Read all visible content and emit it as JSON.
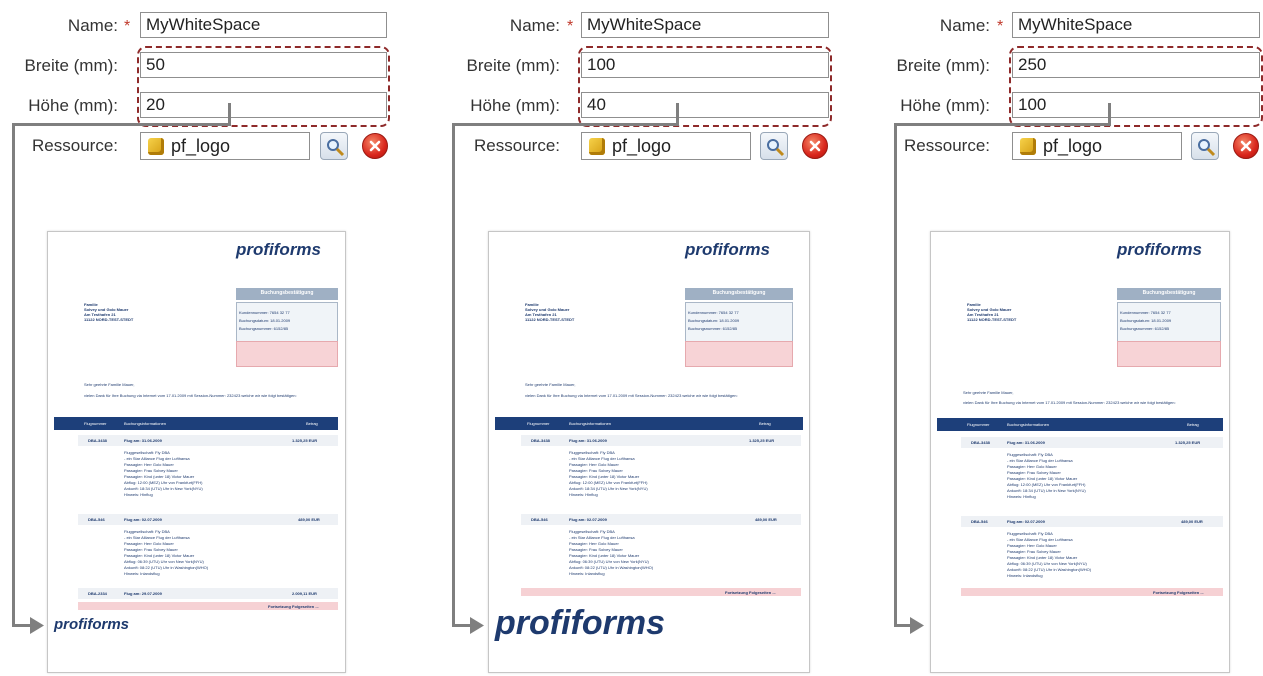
{
  "labels": {
    "name": "Name:",
    "required": "*",
    "breite": "Breite (mm):",
    "hoehe": "Höhe (mm):",
    "ressource": "Ressource:"
  },
  "panels": [
    {
      "name": "MyWhiteSpace",
      "breite": "50",
      "hoehe": "20",
      "resource": "pf_logo"
    },
    {
      "name": "MyWhiteSpace",
      "breite": "100",
      "hoehe": "40",
      "resource": "pf_logo"
    },
    {
      "name": "MyWhiteSpace",
      "breite": "250",
      "hoehe": "100",
      "resource": "pf_logo"
    }
  ],
  "icons": {
    "resource": "cube-icon",
    "search": "magnifier-icon",
    "delete": "delete-x-icon"
  },
  "colors": {
    "highlight": "#8e2a2a",
    "brand": "#1e3a6e",
    "required": "#c0392b"
  },
  "document": {
    "logo": "profiforms",
    "address": [
      "Familie",
      "Solvey und Golo Mauer",
      "Am Testhafen 21",
      "11122 NORD-TEST-STEDT"
    ],
    "booking_title": "Buchungsbestätigung",
    "booking_info": [
      "Kundennummer: 7654 32 77",
      "Buchungsdatum: 18.01.2009",
      "Buchungsnummer: 6152/85"
    ],
    "greeting": "Sehr geehrte Familie Mauer,",
    "intro": "vielen Dank für Ihre Buchung via Internet vom 17.01.2009 mit Session-Nummer: 232423 welche wir wie folgt bestätigen:",
    "table_headers": [
      "Flugnummer",
      "Buchungsinformationen",
      "Betrag"
    ],
    "flights": [
      {
        "number": "DBA-3438",
        "title": "Flug am: 31.06.2009",
        "amount": "1.325,25 EUR",
        "details": [
          "Fluggesellschaft: Fly DBA",
          "- ein Star Alliance Flug der Lufthansa",
          "Passagier: Herr Golo Mauer",
          "Passagier: Frau Solvey Mauer",
          "Passagier: Kind (unter 18) Victor Mauer",
          "Abflug: 12:00 (MEZ) Uhr von Frankfurt(FFH)",
          "Ankunft: 18:34 (UTU) Uhr in New York(NYU)",
          "Hinweis: Hinflug"
        ]
      },
      {
        "number": "DBA-546",
        "title": "Flug am: 02.07.2009",
        "amount": "489,00 EUR",
        "details": [
          "Fluggesellschaft: Fly DBA",
          "- ein Star Alliance Flug der Lufthansa",
          "Passagier: Herr Golo Mauer",
          "Passagier: Frau Solvey Mauer",
          "Passagier: Kind (unter 18) Victor Mauer",
          "Abflug: 06:39 (UTU) Uhr von New York(NYU)",
          "Ankunft: 08:22 (UTU) Uhr in Washington(WHO)",
          "Hinweis: Inlandsflug"
        ]
      },
      {
        "number": "DBA-2334",
        "title": "Flug am: 29.07.2009",
        "amount": "2.009,11 EUR",
        "details": []
      }
    ],
    "continuation": "Fortsetzung Folgeseiten ..."
  }
}
